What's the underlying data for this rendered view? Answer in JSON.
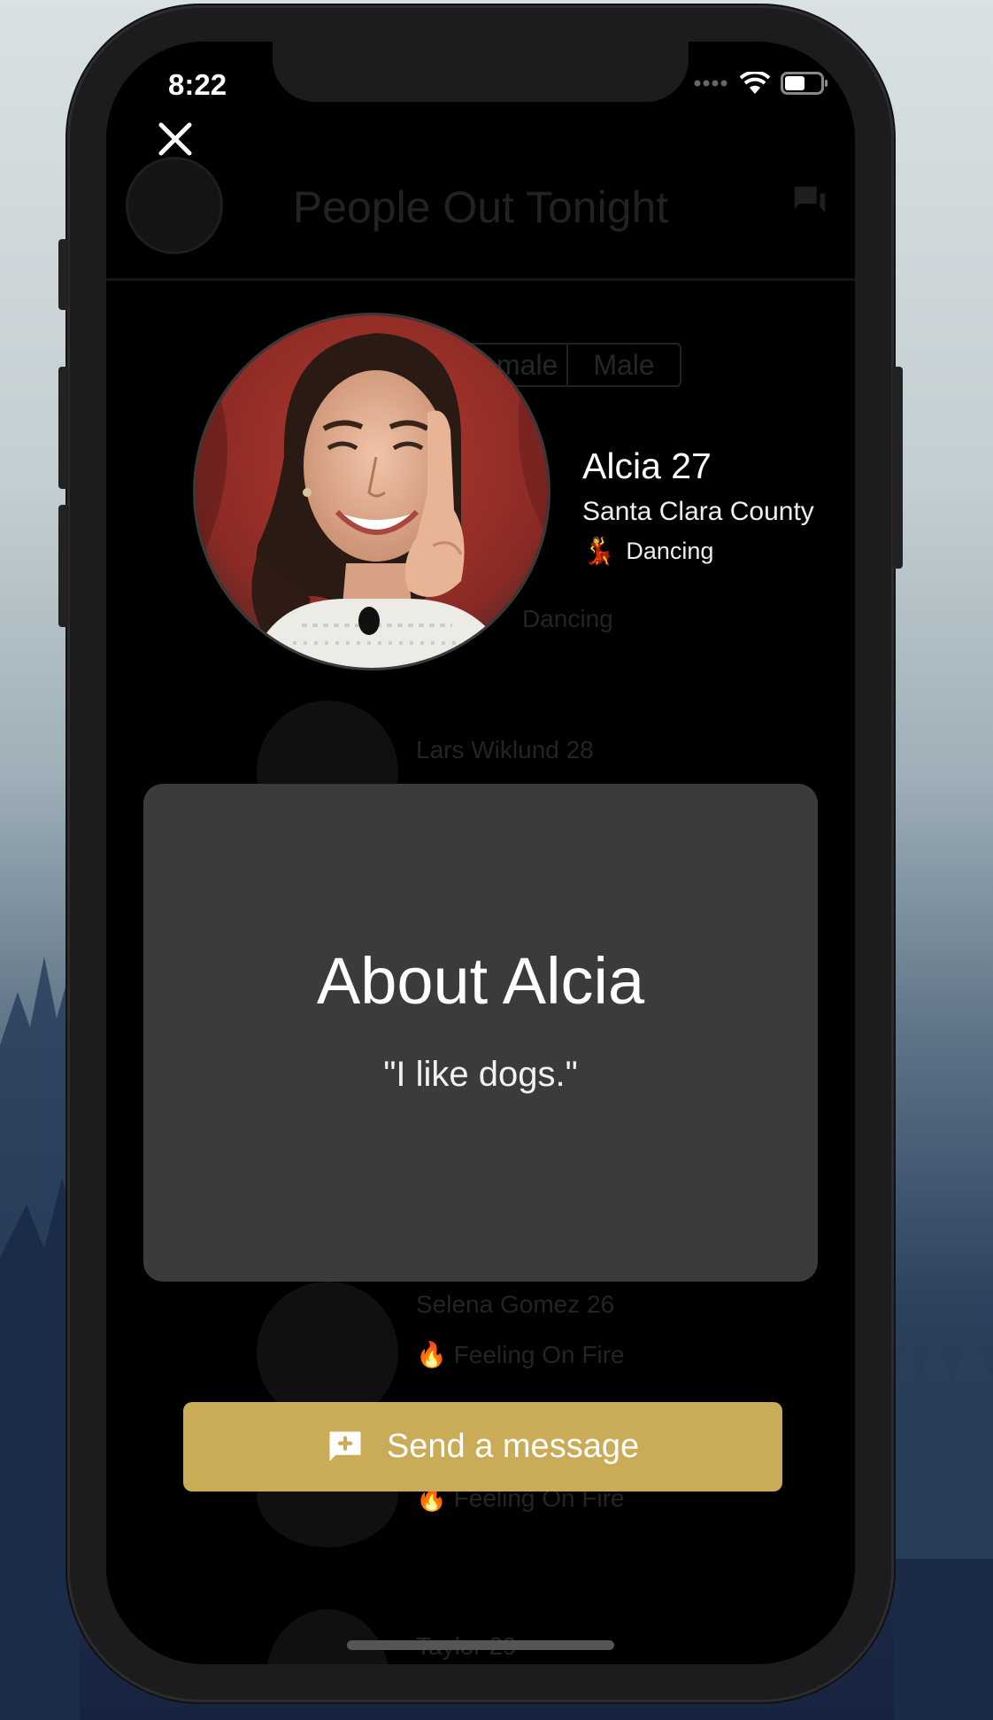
{
  "status_bar": {
    "time": "8:22"
  },
  "background_app": {
    "title": "People Out Tonight",
    "segment_options": [
      "Female",
      "Male"
    ],
    "rows": [
      {
        "name": "",
        "status": "Dancing"
      },
      {
        "name": "Lars Wiklund 28",
        "status": ""
      },
      {
        "name": "Selena Gomez 26",
        "status": "🔥 Feeling On Fire"
      },
      {
        "name": "",
        "status": "🔥 Feeling On Fire"
      },
      {
        "name": "Taylor 29",
        "status": ""
      }
    ]
  },
  "profile": {
    "name": "Alcia 27",
    "location": "Santa Clara County",
    "activity": "Dancing",
    "activity_icon": "💃",
    "photo_icon": "profile-photo"
  },
  "about": {
    "title": "About Alcia",
    "quote": "\"I like dogs.\""
  },
  "actions": {
    "send_message_label": "Send a message",
    "send_message_icon": "add-comment-icon"
  },
  "colors": {
    "accent": "#c9ab58",
    "card": "#3b3b3b",
    "screen": "#000000"
  }
}
